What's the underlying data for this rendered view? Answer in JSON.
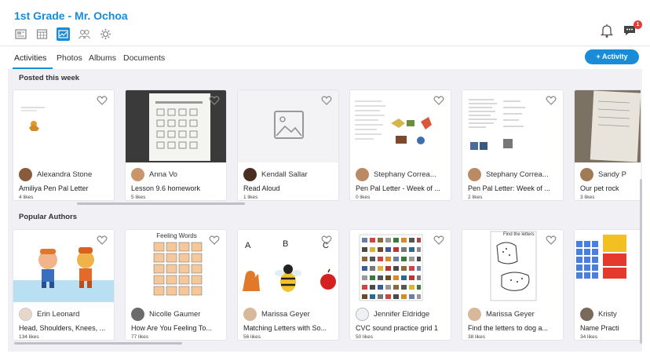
{
  "header": {
    "class_title": "1st Grade - Mr. Ochoa",
    "tool_icons": [
      "newspaper-icon",
      "calendar-icon",
      "activity-feed-icon",
      "people-icon",
      "gear-icon"
    ],
    "notification_badge": "1"
  },
  "tabs": [
    {
      "label": "Activities",
      "active": true
    },
    {
      "label": "Photos"
    },
    {
      "label": "Albums"
    },
    {
      "label": "Documents"
    }
  ],
  "add_activity_label": "+ Activity",
  "colors": {
    "accent": "#1a8bd6",
    "panel": "#f0f0f5",
    "badge": "#e53b3b"
  },
  "sections": [
    {
      "title": "Posted this week",
      "cards": [
        {
          "author": "Alexandra Stone",
          "title": "Amiliya Pen Pal Letter",
          "likes": "4 likes",
          "thumb": "letter-drawing"
        },
        {
          "author": "Anna Vo",
          "title": "Lesson 9.6 homework",
          "likes": "5 likes",
          "thumb": "worksheet-photo"
        },
        {
          "author": "Kendall Sallar",
          "title": "Read Aloud",
          "likes": "1 likes",
          "thumb": "placeholder"
        },
        {
          "author": "Stephany Correa...",
          "title": "Pen Pal Letter - Week of ...",
          "likes": "0 likes",
          "thumb": "document"
        },
        {
          "author": "Stephany Correa...",
          "title": "Pen Pal Letter: Week of ...",
          "likes": "2 likes",
          "thumb": "document"
        },
        {
          "author": "Sandy P",
          "title": "Our pet rock",
          "likes": "3 likes",
          "thumb": "photo-paper"
        }
      ]
    },
    {
      "title": "Popular Authors",
      "cards": [
        {
          "author": "Erin Leonard",
          "title": "Head, Shoulders, Knees, ...",
          "likes": "134 likes",
          "thumb": "cartoon"
        },
        {
          "author": "Nicolle Gaumer",
          "title": "How Are You Feeling To...",
          "likes": "77 likes",
          "thumb": "feelings",
          "thumb_text": "Feeling Words"
        },
        {
          "author": "Marissa Geyer",
          "title": "Matching Letters with So...",
          "likes": "56 likes",
          "thumb": "abc",
          "thumb_letters": [
            "A",
            "B",
            "C"
          ]
        },
        {
          "author": "Jennifer Eldridge",
          "title": "CVC sound practice grid 1",
          "likes": "50 likes",
          "thumb": "grid"
        },
        {
          "author": "Marissa Geyer",
          "title": "Find the letters to dog a...",
          "likes": "38 likes",
          "thumb": "find-letters",
          "thumb_text": "Find the letters"
        },
        {
          "author": "Kristy",
          "title": "Name Practi",
          "likes": "34 likes",
          "thumb": "blocks"
        }
      ]
    }
  ]
}
